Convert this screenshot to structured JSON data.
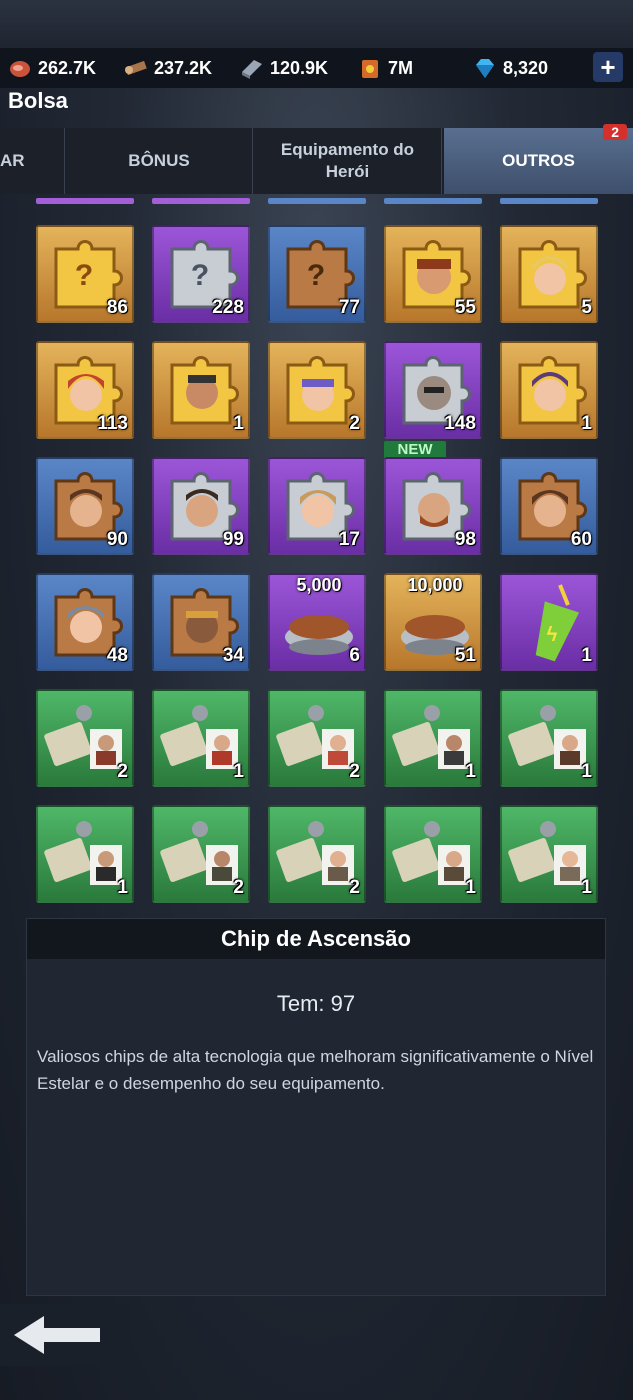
{
  "resources": [
    {
      "icon": "meat-icon",
      "value": "262.7K"
    },
    {
      "icon": "wood-icon",
      "value": "237.2K"
    },
    {
      "icon": "steel-icon",
      "value": "120.9K"
    },
    {
      "icon": "fuel-icon",
      "value": "7M"
    },
    {
      "icon": "diamond-icon",
      "value": "8,320"
    }
  ],
  "plus": "+",
  "title": "Bolsa",
  "tabs": {
    "t0": "AR",
    "t1": "BÔNUS",
    "t2": "Equipamento do Herói",
    "t3": "OUTROS",
    "badge": "2"
  },
  "grid": {
    "r0": [
      "86",
      "228",
      "77",
      "55",
      "5"
    ],
    "r1": [
      "113",
      "1",
      "2",
      "148",
      "1"
    ],
    "r2": [
      "90",
      "99",
      "17",
      "98",
      "60"
    ],
    "r3": [
      "48",
      "34",
      "6",
      "51",
      "1"
    ],
    "r4": [
      "2",
      "1",
      "2",
      "1",
      "1"
    ],
    "r5": [
      "1",
      "2",
      "2",
      "1",
      "1"
    ],
    "bowl_small": "5,000",
    "bowl_large": "10,000",
    "new": "NEW"
  },
  "panel": {
    "name": "Chip de Ascensão",
    "have": "Tem: 97",
    "description": "Valiosos chips de alta tecnologia que melhoram significativamente o Nível Estelar e o desempenho do seu equipamento."
  }
}
